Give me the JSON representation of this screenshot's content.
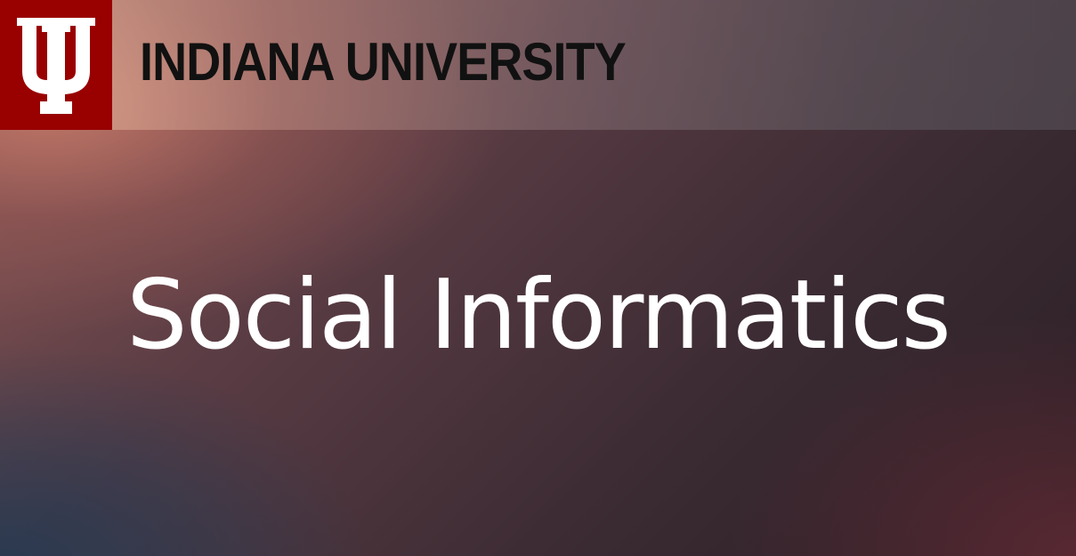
{
  "header": {
    "logo_icon": "iu-trident-logo",
    "university_name": "INDIANA UNIVERSITY",
    "brand_color": "#990000"
  },
  "main": {
    "title": "Social Informatics"
  }
}
